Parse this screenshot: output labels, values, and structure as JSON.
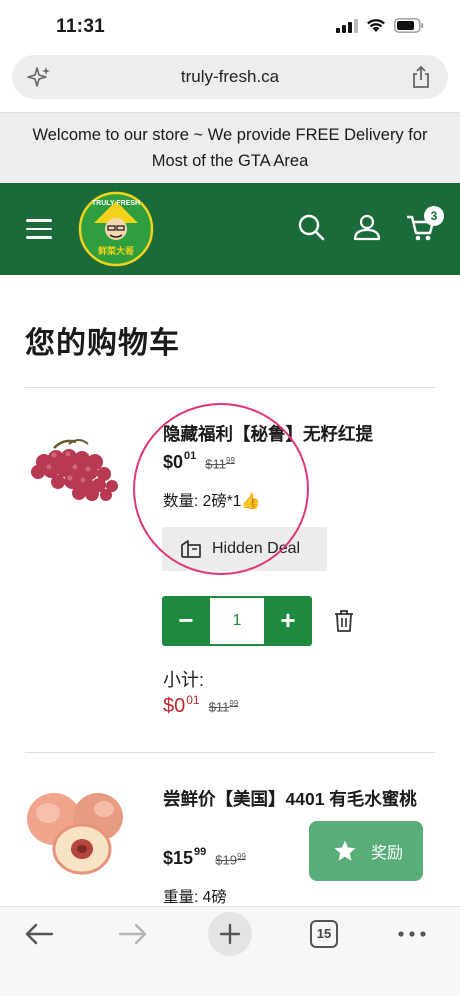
{
  "status_bar": {
    "time": "11:31"
  },
  "browser": {
    "url": "truly-fresh.ca",
    "tab_count": "15"
  },
  "announcement": "Welcome to our store ~ We provide FREE Delivery for Most of the GTA Area",
  "header": {
    "logo_text": "TRULY FRESH",
    "logo_subtext": "鲜菜大哥",
    "cart_count": "3"
  },
  "page_title": "您的购物车",
  "cart_items": [
    {
      "name": "隐藏福利【秘鲁】无籽红提",
      "price_dollars": "$0",
      "price_cents": "01",
      "old_price_dollars": "$11",
      "old_price_cents": "99",
      "meta": "数量: 2磅*1👍",
      "deal_label": "Hidden Deal",
      "quantity": "1",
      "subtotal_label": "小计:",
      "subtotal_dollars": "$0",
      "subtotal_cents": "01",
      "subtotal_old_dollars": "$11",
      "subtotal_old_cents": "99"
    },
    {
      "name": "尝鲜价【美国】4401 有毛水蜜桃",
      "price_dollars": "$15",
      "price_cents": "99",
      "old_price_dollars": "$19",
      "old_price_cents": "99",
      "meta": "重量: 4磅"
    }
  ],
  "reward_button": {
    "label": "奖励"
  },
  "colors": {
    "header_green": "#1b6b3a",
    "qty_green": "#1e8a3e",
    "sale_red": "#c0262d",
    "reward_green": "#58ad79",
    "annotation_pink": "#e0357a"
  },
  "icons": [
    "signal-icon",
    "wifi-icon",
    "battery-icon",
    "sparkle-icon",
    "share-icon",
    "menu-icon",
    "search-icon",
    "user-icon",
    "cart-icon",
    "deal-icon",
    "trash-icon",
    "star-icon",
    "back-icon",
    "forward-icon",
    "plus-icon",
    "more-icon"
  ]
}
